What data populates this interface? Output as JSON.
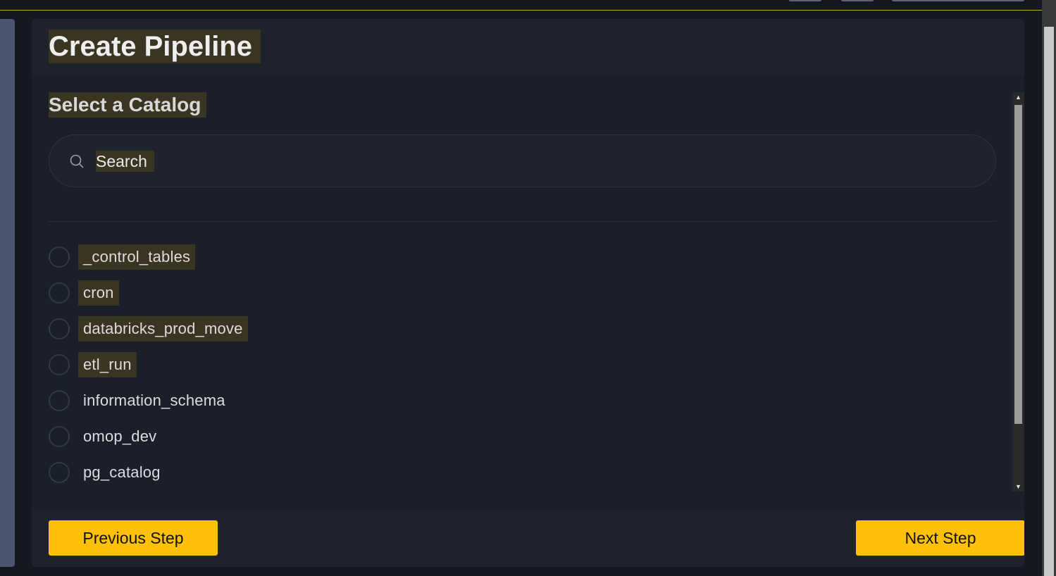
{
  "page": {
    "title": "Create Pipeline",
    "subtitle": "Select a Catalog"
  },
  "search": {
    "placeholder": "Search",
    "value": ""
  },
  "catalogs": [
    {
      "name": "_control_tables",
      "highlighted": true,
      "selected": false
    },
    {
      "name": "cron",
      "highlighted": true,
      "selected": false
    },
    {
      "name": "databricks_prod_move",
      "highlighted": true,
      "selected": false
    },
    {
      "name": "etl_run",
      "highlighted": true,
      "selected": false
    },
    {
      "name": "information_schema",
      "highlighted": false,
      "selected": false
    },
    {
      "name": "omop_dev",
      "highlighted": false,
      "selected": false
    },
    {
      "name": "pg_catalog",
      "highlighted": false,
      "selected": false
    }
  ],
  "footer": {
    "previous_label": "Previous Step",
    "next_label": "Next Step"
  },
  "colors": {
    "accent": "#ffc107",
    "highlight": "#3a3422",
    "background": "#1b1f29"
  },
  "icons": {
    "search": "search-icon",
    "scroll_up": "scroll-up-arrow-icon",
    "scroll_down": "scroll-down-arrow-icon"
  }
}
